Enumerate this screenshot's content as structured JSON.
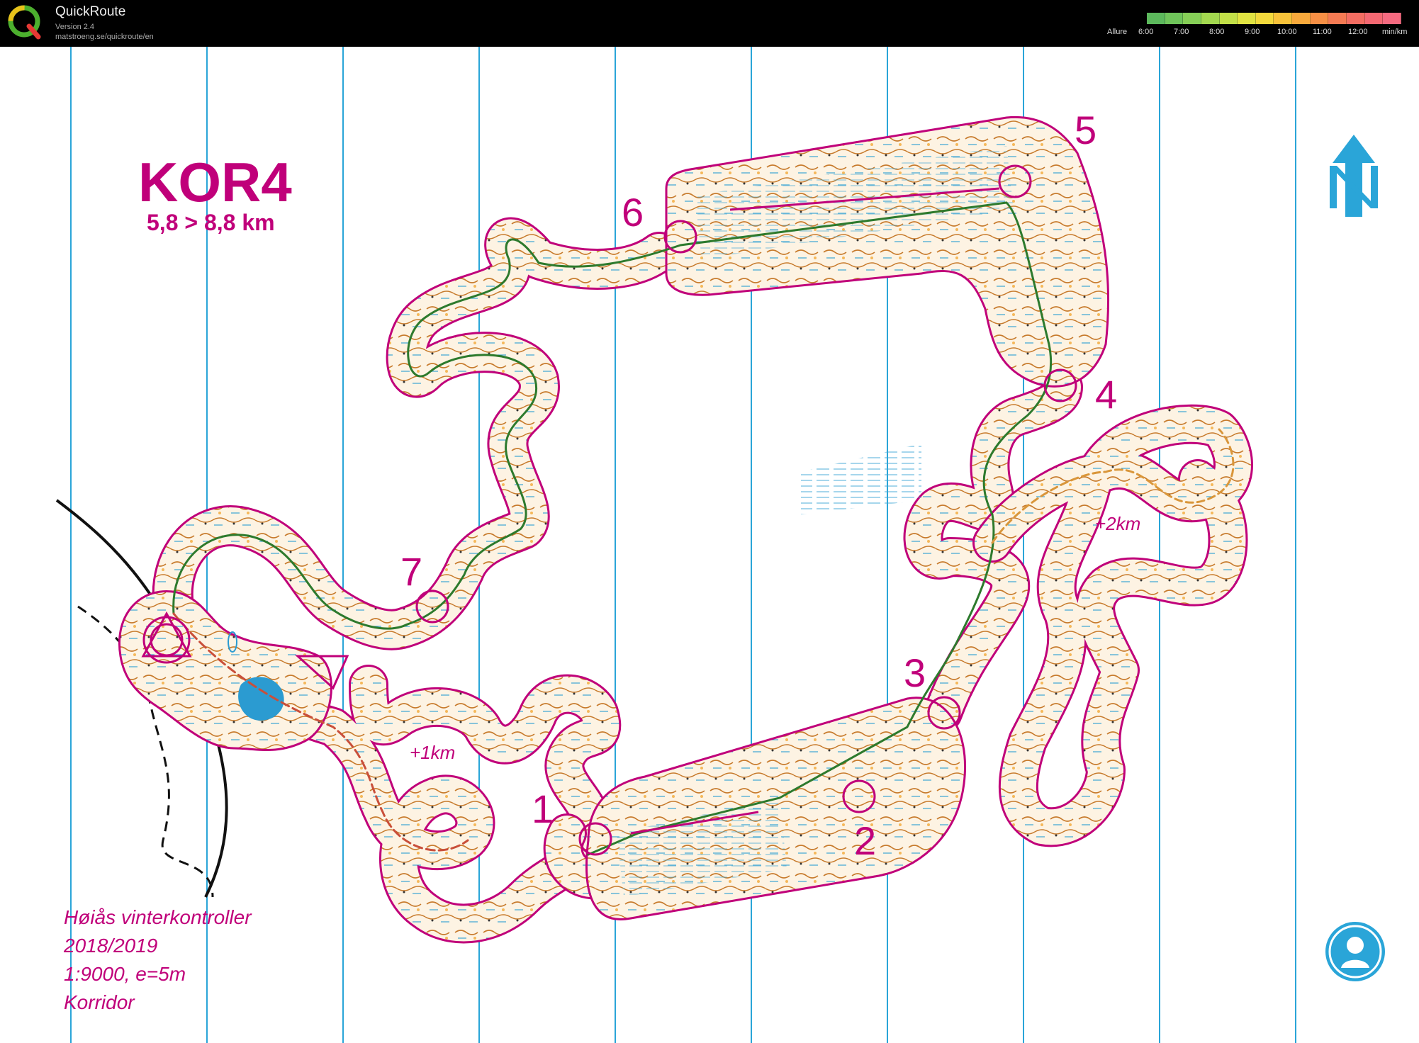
{
  "app": {
    "name": "QuickRoute",
    "version": "Version 2.4",
    "url": "matstroeng.se/quickroute/en"
  },
  "pace_scale": {
    "label": "Allure",
    "ticks": [
      "6:00",
      "7:00",
      "8:00",
      "9:00",
      "10:00",
      "11:00",
      "12:00"
    ],
    "unit": "min/km",
    "colors": [
      "#5cb85c",
      "#6fc45a",
      "#86cf57",
      "#a3d84f",
      "#c2df48",
      "#e1e342",
      "#f3d93c",
      "#f7c23a",
      "#f8a93c",
      "#f68f45",
      "#f47a53",
      "#f36d62",
      "#f46872",
      "#f56a80"
    ]
  },
  "map": {
    "title": "KOR4",
    "distance": "5,8 > 8,8 km",
    "controls": [
      "1",
      "2",
      "3",
      "4",
      "5",
      "6",
      "7"
    ],
    "loop_label_1": "+1km",
    "loop_label_2": "+2km",
    "info": [
      "Høiås vinterkontroller",
      "2018/2019",
      "1:9000, e=5m",
      "Korridor"
    ],
    "colors": {
      "course": "#c0007a",
      "meridian": "#2aa5d8",
      "route": "#2d7a2d",
      "terrain_fill": "#fdf3e3",
      "contour": "#c77a2b",
      "water": "#3aa5d4"
    }
  }
}
